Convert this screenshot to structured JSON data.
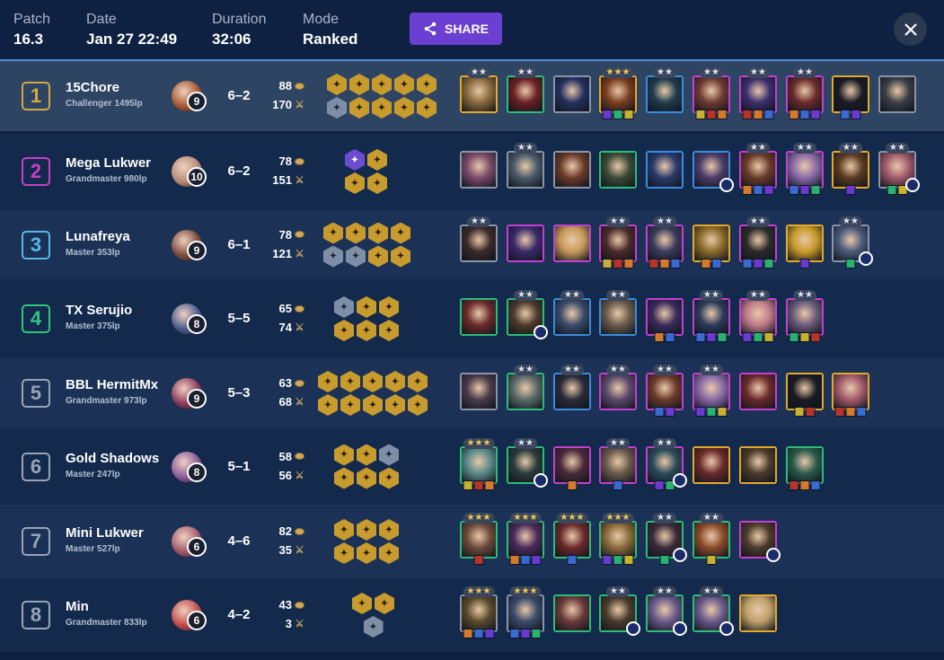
{
  "header": {
    "patch_label": "Patch",
    "patch_value": "16.3",
    "date_label": "Date",
    "date_value": "Jan 27 22:49",
    "duration_label": "Duration",
    "duration_value": "32:06",
    "mode_label": "Mode",
    "mode_value": "Ranked",
    "share_label": "SHARE"
  },
  "colors": {
    "place": [
      "#d4a944",
      "#c73fc6",
      "#58b8e8",
      "#32c47e",
      "#9aa4b5",
      "#9aa4b5",
      "#9aa4b5",
      "#9aa4b5"
    ],
    "unit_border": {
      "gray": "#8a95a8",
      "green": "#2bbd7a",
      "blue": "#3a8de0",
      "purple": "#c53fd3",
      "gold": "#e3a92b"
    }
  },
  "players": [
    {
      "place": "1",
      "name": "15Chore",
      "rank": "Challenger 1495lp",
      "level": "9",
      "record": "6–2",
      "gold": "88",
      "damage": "170",
      "avatar_color": "#a3572f",
      "traits": [
        [
          "gold",
          "gold",
          "gold",
          "gold",
          "gold"
        ],
        [
          "silver",
          "gold",
          "gold",
          "gold",
          "gold"
        ]
      ],
      "units": [
        {
          "border": "gold",
          "stars": 2,
          "color": "#8a6a3c",
          "items": 0
        },
        {
          "border": "green",
          "stars": 2,
          "color": "#6b2024",
          "items": 0
        },
        {
          "border": "gray",
          "stars": 0,
          "color": "#243060",
          "items": 0
        },
        {
          "border": "gold",
          "stars": 3,
          "color": "#7a3d20",
          "items": 3
        },
        {
          "border": "blue",
          "stars": 2,
          "color": "#1f3b4d",
          "items": 0
        },
        {
          "border": "purple",
          "stars": 2,
          "color": "#6e3a32",
          "items": 3
        },
        {
          "border": "purple",
          "stars": 2,
          "color": "#3c2e6e",
          "items": 3
        },
        {
          "border": "purple",
          "stars": 2,
          "color": "#6a2a2a",
          "items": 3
        },
        {
          "border": "gold",
          "stars": 0,
          "color": "#1a1a24",
          "items": 2
        },
        {
          "border": "gray",
          "stars": 0,
          "color": "#3a3d44",
          "items": 0
        }
      ]
    },
    {
      "place": "2",
      "name": "Mega Lukwer",
      "rank": "Grandmaster 980lp",
      "level": "10",
      "record": "6–2",
      "gold": "78",
      "damage": "151",
      "avatar_color": "#b68a78",
      "traits": [
        [
          "purple",
          "gold"
        ],
        [
          "gold",
          "gold"
        ]
      ],
      "units": [
        {
          "border": "gray",
          "stars": 0,
          "color": "#7a4a6a",
          "items": 0
        },
        {
          "border": "gray",
          "stars": 2,
          "color": "#4a5a6a",
          "items": 0
        },
        {
          "border": "gray",
          "stars": 0,
          "color": "#6a3a2a",
          "items": 0
        },
        {
          "border": "green",
          "stars": 0,
          "color": "#3a4a38",
          "items": 0
        },
        {
          "border": "blue",
          "stars": 0,
          "color": "#2a3a6a",
          "items": 0
        },
        {
          "border": "blue",
          "stars": 0,
          "color": "#4a3a6a",
          "items": 0,
          "emblem": true
        },
        {
          "border": "purple",
          "stars": 2,
          "color": "#6a3a2a",
          "items": 3
        },
        {
          "border": "purple",
          "stars": 2,
          "color": "#8a6aa8",
          "items": 3
        },
        {
          "border": "gold",
          "stars": 2,
          "color": "#5a3a20",
          "items": 1
        },
        {
          "border": "gray",
          "stars": 2,
          "color": "#a05a6a",
          "items": 2,
          "emblem": true
        }
      ]
    },
    {
      "place": "3",
      "name": "Lunafreya",
      "rank": "Master 353lp",
      "level": "9",
      "record": "6–1",
      "gold": "78",
      "damage": "121",
      "avatar_color": "#7a4a3a",
      "traits": [
        [
          "gold",
          "gold",
          "gold",
          "gold"
        ],
        [
          "silver",
          "silver",
          "gold",
          "gold"
        ]
      ],
      "units": [
        {
          "border": "gray",
          "stars": 2,
          "color": "#3a2a2a",
          "items": 0
        },
        {
          "border": "purple",
          "stars": 0,
          "color": "#3a2a6a",
          "items": 0
        },
        {
          "border": "purple",
          "stars": 0,
          "color": "#c89a5a",
          "items": 0
        },
        {
          "border": "purple",
          "stars": 2,
          "color": "#4a2a2a",
          "items": 3
        },
        {
          "border": "purple",
          "stars": 2,
          "color": "#3a3a5a",
          "items": 3
        },
        {
          "border": "gold",
          "stars": 0,
          "color": "#8a6a2a",
          "items": 2
        },
        {
          "border": "purple",
          "stars": 2,
          "color": "#2a2a2a",
          "items": 3
        },
        {
          "border": "gold",
          "stars": 0,
          "color": "#c89a2a",
          "items": 1
        },
        {
          "border": "gray",
          "stars": 2,
          "color": "#4a5a7a",
          "items": 1,
          "emblem": true
        }
      ]
    },
    {
      "place": "4",
      "name": "TX Serujio",
      "rank": "Master 375lp",
      "level": "8",
      "record": "5–5",
      "gold": "65",
      "damage": "74",
      "avatar_color": "#4a5a8a",
      "traits": [
        [
          "silver",
          "gold",
          "gold"
        ],
        [
          "gold",
          "gold",
          "gold"
        ]
      ],
      "units": [
        {
          "border": "green",
          "stars": 0,
          "color": "#6a2a2a",
          "items": 0
        },
        {
          "border": "green",
          "stars": 2,
          "color": "#4a3a2a",
          "items": 0,
          "emblem": true
        },
        {
          "border": "blue",
          "stars": 2,
          "color": "#3a4a6a",
          "items": 0
        },
        {
          "border": "blue",
          "stars": 2,
          "color": "#6a5a4a",
          "items": 0
        },
        {
          "border": "purple",
          "stars": 0,
          "color": "#3a2a5a",
          "items": 2
        },
        {
          "border": "purple",
          "stars": 2,
          "color": "#2a3a5a",
          "items": 3
        },
        {
          "border": "purple",
          "stars": 2,
          "color": "#c07a8a",
          "items": 3
        },
        {
          "border": "purple",
          "stars": 2,
          "color": "#6a5a7a",
          "items": 3
        }
      ]
    },
    {
      "place": "5",
      "name": "BBL HermitMx",
      "rank": "Grandmaster 973lp",
      "level": "9",
      "record": "5–3",
      "gold": "63",
      "damage": "68",
      "avatar_color": "#8a3a5a",
      "traits": [
        [
          "gold",
          "gold",
          "gold",
          "gold",
          "gold"
        ],
        [
          "gold",
          "gold",
          "gold",
          "gold",
          "gold"
        ]
      ],
      "units": [
        {
          "border": "gray",
          "stars": 0,
          "color": "#4a3a4a",
          "items": 0
        },
        {
          "border": "green",
          "stars": 2,
          "color": "#5a6a6a",
          "items": 0
        },
        {
          "border": "blue",
          "stars": 2,
          "color": "#2a2a3a",
          "items": 0
        },
        {
          "border": "purple",
          "stars": 2,
          "color": "#5a4a6a",
          "items": 0
        },
        {
          "border": "purple",
          "stars": 2,
          "color": "#6a3a2a",
          "items": 2
        },
        {
          "border": "purple",
          "stars": 2,
          "color": "#8a6aa8",
          "items": 3
        },
        {
          "border": "purple",
          "stars": 0,
          "color": "#6a2a2a",
          "items": 0
        },
        {
          "border": "gold",
          "stars": 0,
          "color": "#1a1a24",
          "items": 2
        },
        {
          "border": "gold",
          "stars": 0,
          "color": "#a05a6a",
          "items": 3
        }
      ]
    },
    {
      "place": "6",
      "name": "Gold Shadows",
      "rank": "Master 247lp",
      "level": "8",
      "record": "5–1",
      "gold": "58",
      "damage": "56",
      "avatar_color": "#8a5a9a",
      "traits": [
        [
          "gold",
          "gold",
          "silver"
        ],
        [
          "gold",
          "gold",
          "gold"
        ]
      ],
      "units": [
        {
          "border": "green",
          "stars": 3,
          "color": "#5a8a8a",
          "items": 3
        },
        {
          "border": "green",
          "stars": 2,
          "color": "#2a3a3a",
          "items": 0,
          "emblem": true
        },
        {
          "border": "purple",
          "stars": 0,
          "color": "#4a2a3a",
          "items": 1
        },
        {
          "border": "purple",
          "stars": 2,
          "color": "#6a5a4a",
          "items": 1
        },
        {
          "border": "purple",
          "stars": 2,
          "color": "#2a4a5a",
          "items": 2,
          "emblem": true
        },
        {
          "border": "gold",
          "stars": 0,
          "color": "#6a2a2a",
          "items": 0
        },
        {
          "border": "gold",
          "stars": 0,
          "color": "#4a3a2a",
          "items": 0
        },
        {
          "border": "green",
          "stars": 0,
          "color": "#2a5a4a",
          "items": 3
        }
      ]
    },
    {
      "place": "7",
      "name": "Mini Lukwer",
      "rank": "Master 527lp",
      "level": "6",
      "record": "4–6",
      "gold": "82",
      "damage": "35",
      "avatar_color": "#a05a6a",
      "traits": [
        [
          "gold",
          "gold",
          "gold"
        ],
        [
          "gold",
          "gold",
          "gold"
        ]
      ],
      "units": [
        {
          "border": "green",
          "stars": 3,
          "color": "#6a4a3a",
          "items": 1
        },
        {
          "border": "green",
          "stars": 3,
          "color": "#4a2a5a",
          "items": 3
        },
        {
          "border": "green",
          "stars": 3,
          "color": "#6a2a2a",
          "items": 1
        },
        {
          "border": "green",
          "stars": 3,
          "color": "#8a6a3a",
          "items": 3
        },
        {
          "border": "green",
          "stars": 2,
          "color": "#3a2a3a",
          "items": 1,
          "emblem": true
        },
        {
          "border": "green",
          "stars": 2,
          "color": "#8a4a2a",
          "items": 1
        },
        {
          "border": "purple",
          "stars": 0,
          "color": "#4a3a2a",
          "items": 0,
          "emblem": true
        }
      ]
    },
    {
      "place": "8",
      "name": "Min",
      "rank": "Grandmaster 833lp",
      "level": "6",
      "record": "4–2",
      "gold": "43",
      "damage": "3",
      "avatar_color": "#c04a4a",
      "traits": [
        [
          "gold",
          "gold"
        ],
        [
          "silver"
        ]
      ],
      "units": [
        {
          "border": "gray",
          "stars": 3,
          "color": "#5a4a2a",
          "items": 3
        },
        {
          "border": "gray",
          "stars": 3,
          "color": "#3a4a6a",
          "items": 3
        },
        {
          "border": "green",
          "stars": 0,
          "color": "#6a3a3a",
          "items": 0
        },
        {
          "border": "green",
          "stars": 2,
          "color": "#4a3a2a",
          "items": 0,
          "emblem": true
        },
        {
          "border": "green",
          "stars": 2,
          "color": "#6a5a8a",
          "items": 0,
          "emblem": true
        },
        {
          "border": "green",
          "stars": 2,
          "color": "#6a5a8a",
          "items": 0,
          "emblem": true
        },
        {
          "border": "gold",
          "stars": 0,
          "color": "#c0a06a",
          "items": 0
        }
      ]
    }
  ]
}
